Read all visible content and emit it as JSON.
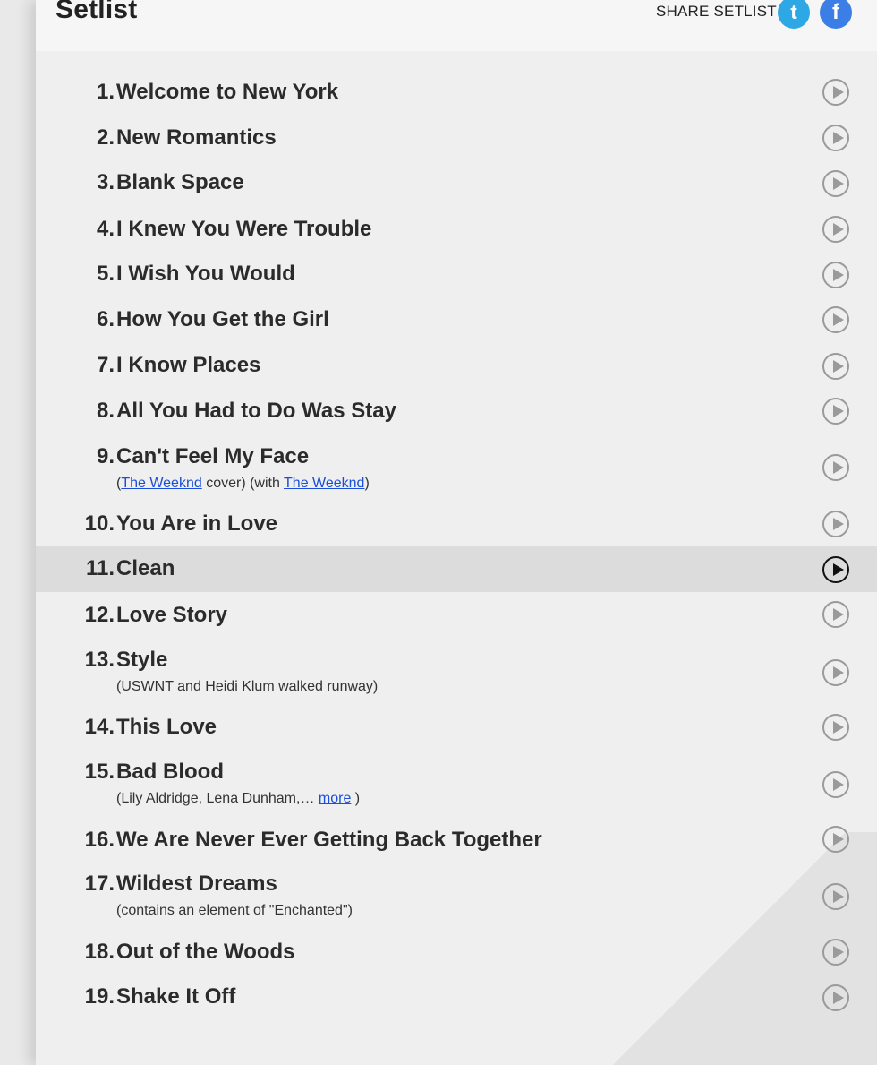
{
  "header": {
    "title": "Setlist",
    "share_label": "SHARE SETLIST",
    "twitter_icon": "t",
    "facebook_icon": "f"
  },
  "colors": {
    "link": "#1b4fd8",
    "twitter": "#2ea8e4",
    "facebook": "#3b7ee6",
    "active_row": "#dcdcdc"
  },
  "songs": [
    {
      "number": "1.",
      "title": "Welcome to New York"
    },
    {
      "number": "2.",
      "title": "New Romantics"
    },
    {
      "number": "3.",
      "title": "Blank Space"
    },
    {
      "number": "4.",
      "title": "I Knew You Were Trouble"
    },
    {
      "number": "5.",
      "title": "I Wish You Would"
    },
    {
      "number": "6.",
      "title": "How You Get the Girl"
    },
    {
      "number": "7.",
      "title": "I Know Places"
    },
    {
      "number": "8.",
      "title": "All You Had to Do Was Stay"
    },
    {
      "number": "9.",
      "title": "Can't Feel My Face",
      "note": {
        "open": "(",
        "link1": "The Weeknd",
        "mid": " cover) (with ",
        "link2": "The Weeknd",
        "close": ")"
      }
    },
    {
      "number": "10.",
      "title": "You Are in Love"
    },
    {
      "number": "11.",
      "title": "Clean",
      "active": true
    },
    {
      "number": "12.",
      "title": "Love Story"
    },
    {
      "number": "13.",
      "title": "Style",
      "note_text": "(USWNT and Heidi Klum walked runway)"
    },
    {
      "number": "14.",
      "title": "This Love"
    },
    {
      "number": "15.",
      "title": "Bad Blood",
      "note_more": {
        "text": "(Lily Aldridge, Lena Dunham,… ",
        "link": "more",
        "close": " )"
      }
    },
    {
      "number": "16.",
      "title": "We Are Never Ever Getting Back Together"
    },
    {
      "number": "17.",
      "title": "Wildest Dreams",
      "note_text": "(contains an element of \"Enchanted\")"
    },
    {
      "number": "18.",
      "title": "Out of the Woods"
    },
    {
      "number": "19.",
      "title": "Shake It Off"
    }
  ]
}
